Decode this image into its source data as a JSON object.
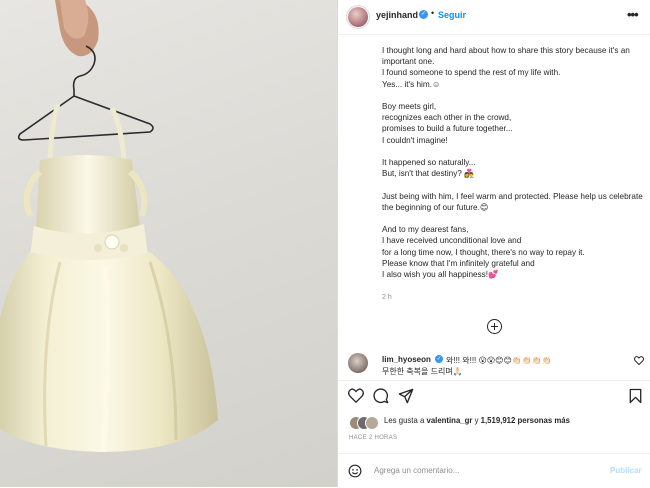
{
  "header": {
    "username": "yejinhand",
    "verified_icon": "verified-badge-icon",
    "separator": "•",
    "follow_label": "Seguir",
    "more_label": "•••"
  },
  "caption": {
    "lines": [
      "I thought long and hard about how to share this story because it's an important one.",
      "I found someone to spend the rest of my life with.",
      "Yes... it's him.☺",
      "",
      "Boy meets girl,",
      "recognizes each other in the crowd,",
      "promises to build a future together...",
      "I couldn't imagine!",
      "",
      "It happened so naturally...",
      "But, isn't that destiny? 👩‍❤️‍👨",
      "",
      "Just being with him, I feel warm and protected. Please help us celebrate the beginning of our future.😊",
      "",
      "And to my dearest fans,",
      "I have received unconditional love and",
      "for a long time now, I thought, there's no way to repay it.",
      "Please know that I'm infinitely grateful and",
      "I also wish you all happiness!💕"
    ],
    "time": "2 h"
  },
  "comment": {
    "username": "lim_hyoseon",
    "text": "와!!! 와!!! 😮😮😊😊👏🏻👏🏻👏🏻👏🏻",
    "line2": "무한한 축복을 드리며🙏🏻"
  },
  "likes": {
    "prefix": "Les gusta a ",
    "user": "valentina_gr",
    "middle": " y ",
    "count": "1,519,912",
    "suffix": " personas más"
  },
  "posted_ago": "HACE 2 HORAS",
  "add_comment": {
    "placeholder": "Agrega un comentario...",
    "publish_label": "Publicar"
  },
  "colors": {
    "accent": "#0095f6",
    "verified": "#3897f0",
    "publish_disabled": "#b2dffc",
    "dress": "#f1ecc9"
  }
}
